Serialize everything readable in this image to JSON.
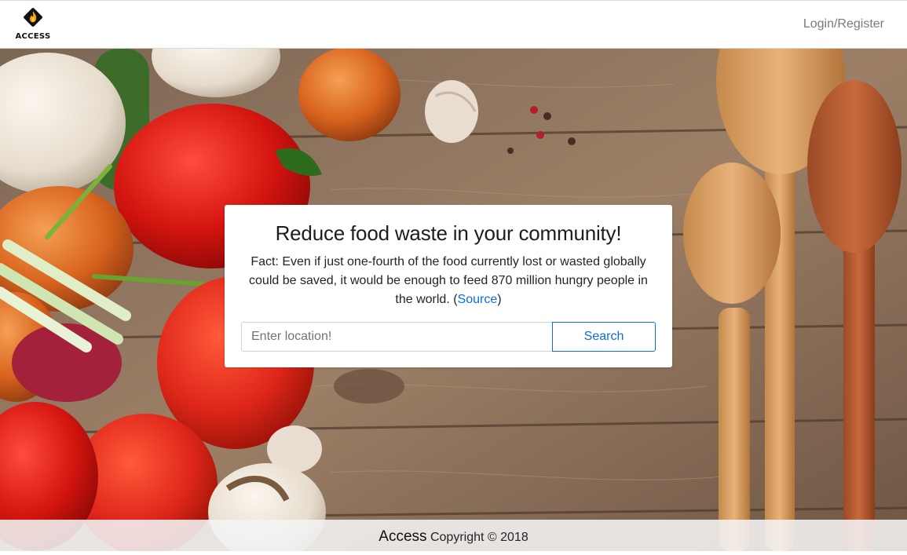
{
  "navbar": {
    "brand_name": "ACCESS",
    "login_label": "Login/Register"
  },
  "hero": {
    "title": "Reduce food waste in your community!",
    "fact_text": "Fact: Even if just one-fourth of the food currently lost or wasted globally could be saved, it would be enough to feed 870 million hungry people in the world. (",
    "source_link": "Source",
    "fact_close": ")",
    "search": {
      "placeholder": "Enter location!",
      "value": "",
      "button_label": "Search"
    }
  },
  "footer": {
    "brand": "Access",
    "copyright": "Copyright © 2018"
  },
  "colors": {
    "accent": "#0b6ee6",
    "link_muted": "#7a7a7a"
  }
}
